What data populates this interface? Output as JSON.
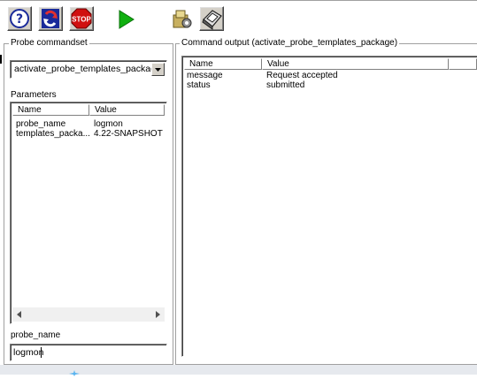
{
  "toolbar": {
    "buttons": [
      {
        "name": "help-button",
        "icon": "help-icon",
        "glyph": "?"
      },
      {
        "name": "refresh-button",
        "icon": "refresh-icon"
      },
      {
        "name": "stop-button",
        "icon": "stop-icon",
        "label": "STOP"
      },
      {
        "name": "run-button",
        "icon": "play-icon"
      },
      {
        "name": "settings-button",
        "icon": "settings-icon"
      },
      {
        "name": "print-button",
        "icon": "printer-icon"
      }
    ]
  },
  "left": {
    "commandset_legend": "Probe commandset",
    "commandset_value": "activate_probe_templates_package",
    "parameters_label": "Parameters",
    "columns": [
      "Name",
      "Value"
    ],
    "rows": [
      {
        "name": "probe_name",
        "value": "logmon"
      },
      {
        "name": "templates_packa...",
        "value": "4.22-SNAPSHOT"
      }
    ],
    "field_label": "probe_name",
    "field_value": "logmon"
  },
  "right": {
    "output_legend": "Command output (activate_probe_templates_package)",
    "columns": [
      "Name",
      "Value"
    ],
    "rows": [
      {
        "name": "message",
        "value": "Request accepted"
      },
      {
        "name": "status",
        "value": "submitted"
      }
    ]
  },
  "colors": {
    "play_green": "#10b010",
    "stop_red": "#d01010",
    "panel_border": "#a0a0a0"
  }
}
